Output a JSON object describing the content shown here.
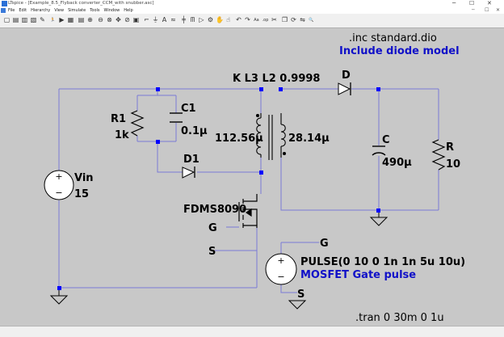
{
  "window": {
    "title": "LTspice - [Example_8.5_Flyback converter_CCM_with snubber.asc]",
    "minimize": "─",
    "maximize": "☐",
    "close": "✕"
  },
  "menu": {
    "items": [
      "File",
      "Edit",
      "Hierarchy",
      "View",
      "Simulate",
      "Tools",
      "Window",
      "Help"
    ]
  },
  "toolbar": {
    "icons": [
      {
        "name": "open-icon",
        "glyph": "▢"
      },
      {
        "name": "save-icon",
        "glyph": "▤"
      },
      {
        "name": "print-icon",
        "glyph": "▥"
      },
      {
        "name": "plot-settings-icon",
        "glyph": "▧"
      },
      {
        "name": "control-panel-icon",
        "glyph": "✎"
      },
      {
        "name": "run-icon",
        "glyph": "🏃"
      },
      {
        "name": "halt-icon",
        "glyph": "▶"
      },
      {
        "name": "tile-icon",
        "glyph": "▦"
      },
      {
        "name": "cascade-icon",
        "glyph": "▤"
      },
      {
        "name": "zoom-in-icon",
        "glyph": "⊕"
      },
      {
        "name": "zoom-out-icon",
        "glyph": "⊖"
      },
      {
        "name": "zoom-fit-icon",
        "glyph": "⊗"
      },
      {
        "name": "pan-icon",
        "glyph": "✥"
      },
      {
        "name": "zoom-area-icon",
        "glyph": "⊘"
      },
      {
        "name": "autorange-icon",
        "glyph": "▣"
      },
      {
        "name": "wire-icon",
        "glyph": "⌐"
      },
      {
        "name": "ground-icon",
        "glyph": "⏚"
      },
      {
        "name": "label-icon",
        "glyph": "A"
      },
      {
        "name": "resistor-icon",
        "glyph": "≈"
      },
      {
        "name": "capacitor-icon",
        "glyph": "╪"
      },
      {
        "name": "inductor-icon",
        "glyph": "ᗰ"
      },
      {
        "name": "diode-icon",
        "glyph": "▷"
      },
      {
        "name": "component-icon",
        "glyph": "⚙"
      },
      {
        "name": "move-icon",
        "glyph": "✋"
      },
      {
        "name": "drag-icon",
        "glyph": "☝"
      },
      {
        "name": "undo-icon",
        "glyph": "↶"
      },
      {
        "name": "redo-icon",
        "glyph": "↷"
      },
      {
        "name": "text-icon",
        "glyph": "Aa"
      },
      {
        "name": "spice-directive-icon",
        "glyph": ".op"
      },
      {
        "name": "delete-icon",
        "glyph": "✂"
      },
      {
        "name": "duplicate-icon",
        "glyph": "❐"
      },
      {
        "name": "rotate-icon",
        "glyph": "⟳"
      },
      {
        "name": "mirror-icon",
        "glyph": "⇋"
      },
      {
        "name": "find-icon",
        "glyph": "🔍"
      }
    ]
  },
  "schematic": {
    "directive_inc": ".inc standard.dio",
    "comment_include": "Include diode model",
    "coupling": "K L3 L2 0.9998",
    "R1_name": "R1",
    "R1_value": "1k",
    "C1_name": "C1",
    "C1_value": "0.1µ",
    "D1_name": "D1",
    "L_primary_value": "112.56µ",
    "L_secondary_value": "28.14µ",
    "D_name": "D",
    "C_name": "C",
    "C_value": "490µ",
    "R_name": "R",
    "R_value": "10",
    "Vin_name": "Vin",
    "Vin_value": "15",
    "mosfet_name": "FDMS8090",
    "mosfet_gate_label": "G",
    "mosfet_source_label": "S",
    "pulse_gate_label": "G",
    "pulse_source_label": "S",
    "pulse_value": "PULSE(0 10 0 1n 1n 5u 10u)",
    "comment_gate": "MOSFET Gate pulse",
    "tran": ".tran 0 30m 0 1u"
  },
  "colors": {
    "wire": "#7a7ad6",
    "component": "#000000",
    "junction": "#0000ff",
    "comment": "#1010c8",
    "source_fill": "#ffffff",
    "background": "#c8c8c8"
  }
}
